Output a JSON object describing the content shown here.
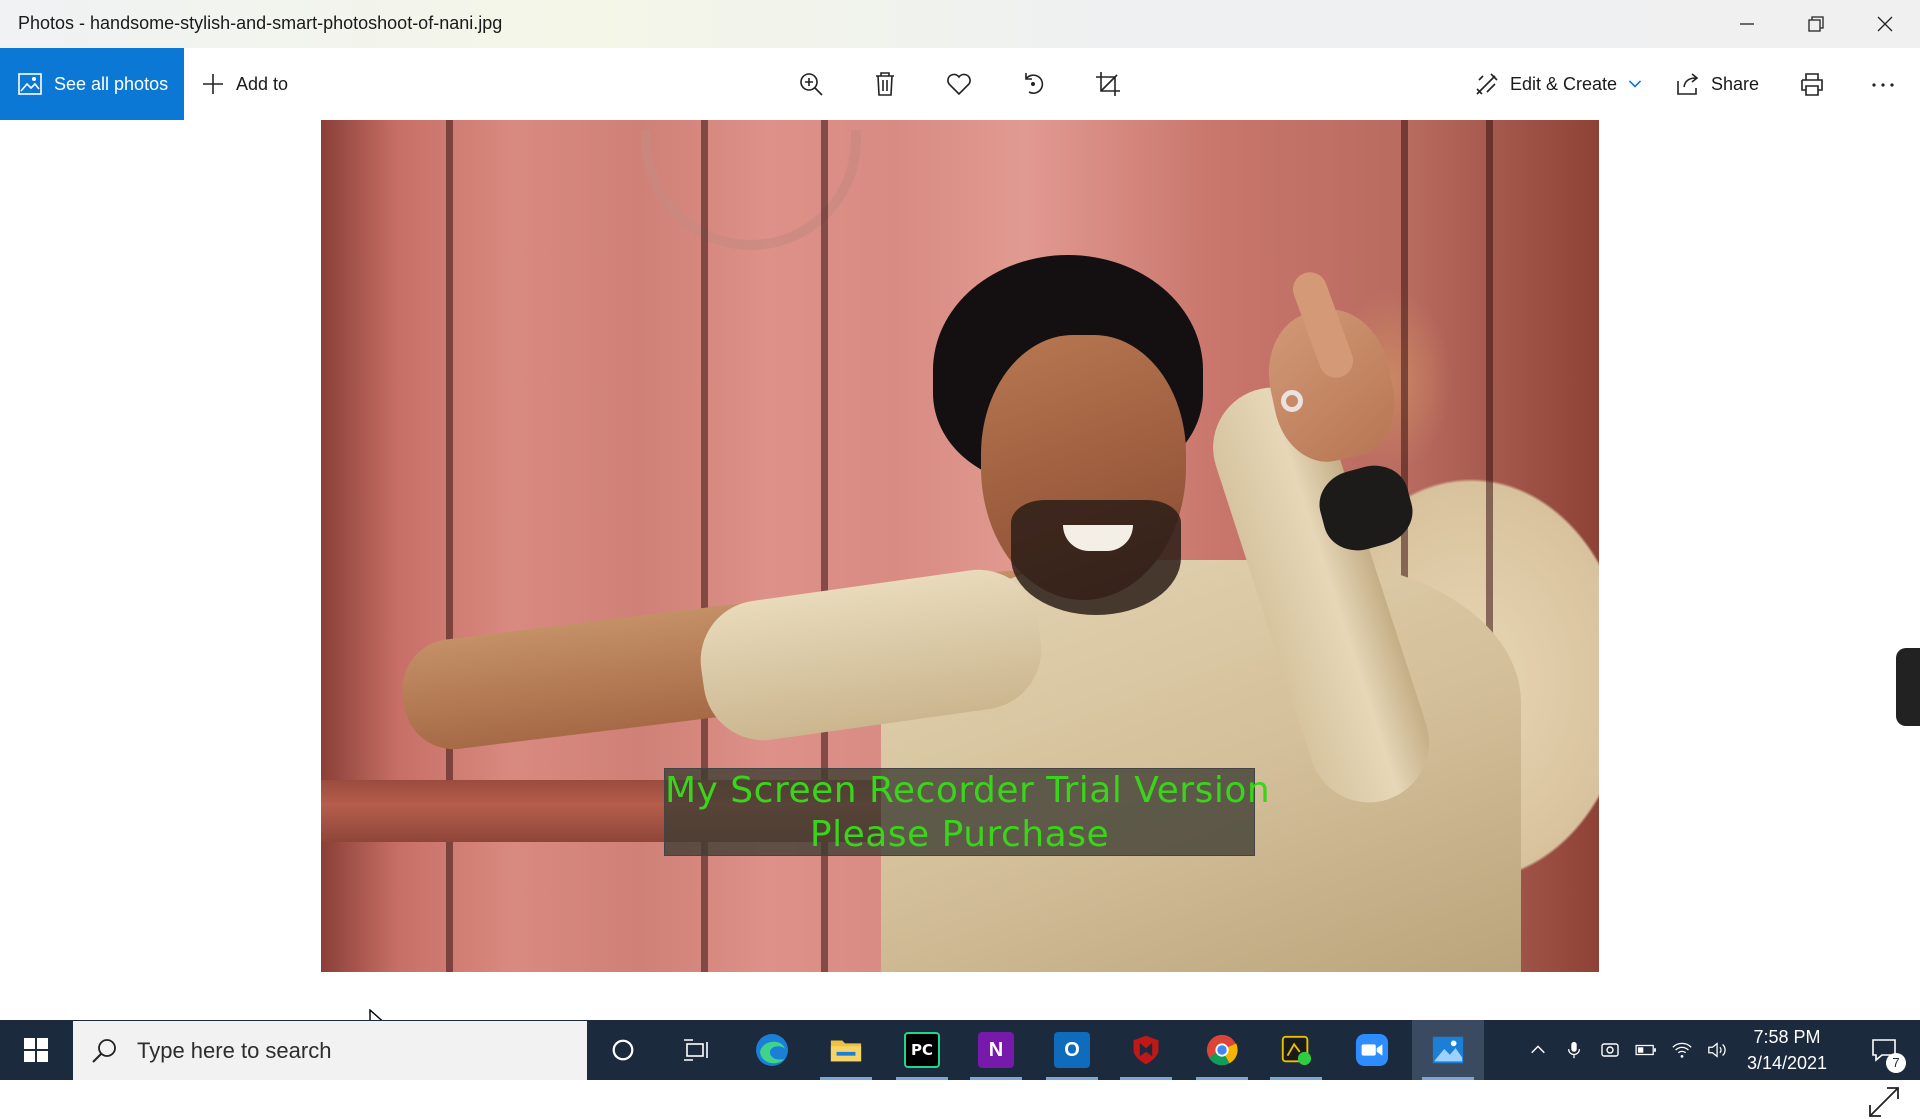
{
  "window": {
    "title": "Photos - handsome-stylish-and-smart-photoshoot-of-nani.jpg",
    "icons": [
      "minimize-icon",
      "restore-icon",
      "close-icon"
    ]
  },
  "toolbar": {
    "see_all_photos": "See all photos",
    "add_to": "Add to",
    "edit_create": "Edit & Create",
    "share": "Share",
    "icons": [
      "zoom-icon",
      "delete-icon",
      "heart-icon",
      "rotate-icon",
      "crop-icon",
      "print-icon",
      "more-icon"
    ],
    "accent_color": "#0a78d4"
  },
  "viewer": {
    "watermark_line1": "My Screen Recorder Trial Version",
    "watermark_line2": "Please Purchase",
    "watermark_color": "#3ad41a"
  },
  "taskbar": {
    "search_placeholder": "Type here to search",
    "time": "7:58 PM",
    "date": "3/14/2021",
    "notification_count": "7",
    "apps": [
      "cortana",
      "task-view",
      "edge",
      "file-explorer",
      "pycharm",
      "onenote",
      "outlook",
      "mcafee",
      "chrome",
      "app",
      "zoom",
      "photos"
    ],
    "pycharm_label": "PC",
    "onenote_label": "N",
    "outlook_label": "O",
    "background_color": "#1c2a3e"
  }
}
